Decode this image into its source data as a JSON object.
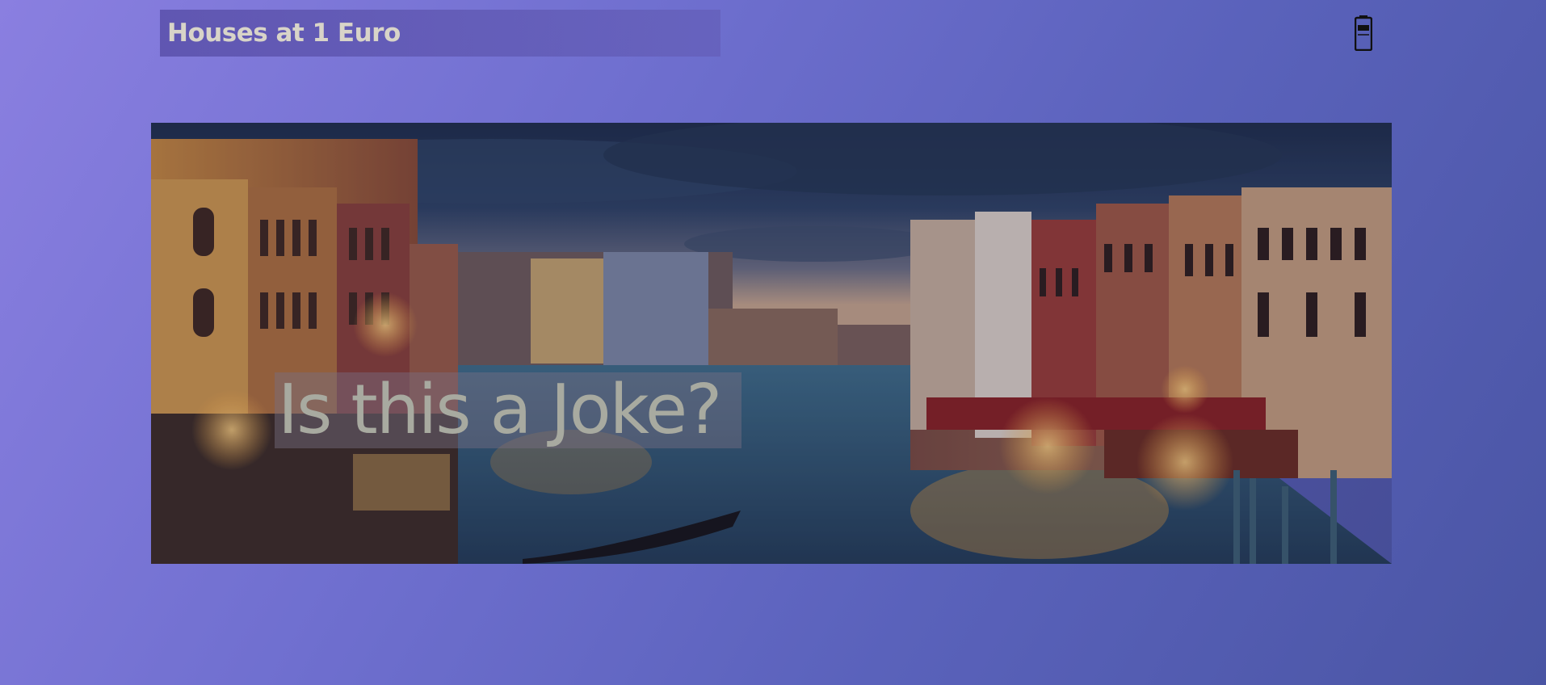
{
  "header": {
    "brand_label": "Houses at 1 Euro",
    "icon": "mobile-device-icon"
  },
  "hero": {
    "title": "Is this a Joke?",
    "image": "venice-grand-canal-photo"
  },
  "colors": {
    "background_start": "#8a7fe0",
    "background_end": "#4a55a4",
    "brand_text": "#d8d4c8",
    "hero_title_text": "#a8aaa0"
  }
}
